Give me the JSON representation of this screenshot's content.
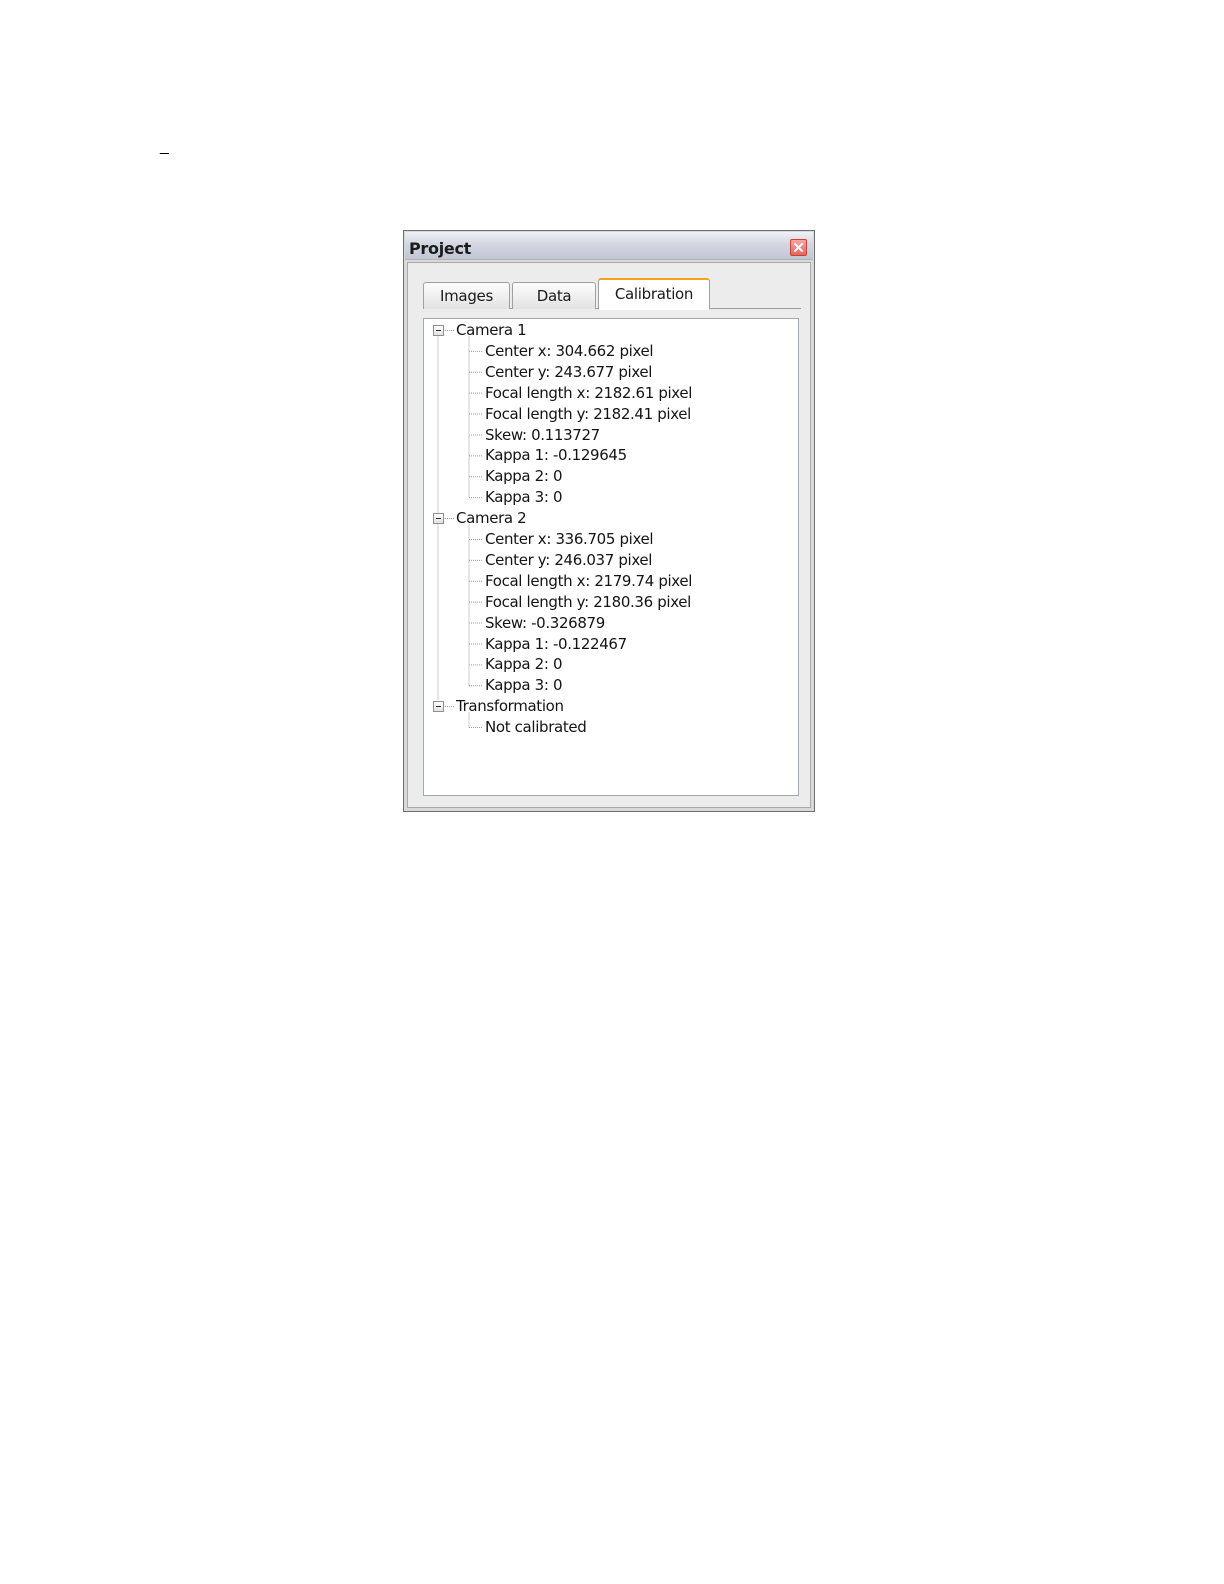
{
  "page": {
    "corner_mark": "_"
  },
  "panel": {
    "title": "Project",
    "close_icon": "close-icon",
    "tabs": [
      {
        "label": "Images",
        "active": false
      },
      {
        "label": "Data",
        "active": false
      },
      {
        "label": "Calibration",
        "active": true
      }
    ],
    "tree": [
      {
        "label": "Camera 1",
        "expanded": true,
        "children": [
          "Center x: 304.662 pixel",
          "Center y: 243.677 pixel",
          "Focal length x: 2182.61 pixel",
          "Focal length y: 2182.41 pixel",
          "Skew: 0.113727",
          "Kappa 1: -0.129645",
          "Kappa 2: 0",
          "Kappa 3: 0"
        ]
      },
      {
        "label": "Camera 2",
        "expanded": true,
        "children": [
          "Center x: 336.705 pixel",
          "Center y: 246.037 pixel",
          "Focal length x: 2179.74 pixel",
          "Focal length y: 2180.36 pixel",
          "Skew: -0.326879",
          "Kappa 1: -0.122467",
          "Kappa 2: 0",
          "Kappa 3: 0"
        ]
      },
      {
        "label": "Transformation",
        "expanded": true,
        "children": [
          "Not calibrated"
        ]
      }
    ]
  },
  "colors": {
    "active_tab_accent": "#f4a31b",
    "close_button": "#e8655c",
    "tree_line": "#9a9a9a"
  }
}
